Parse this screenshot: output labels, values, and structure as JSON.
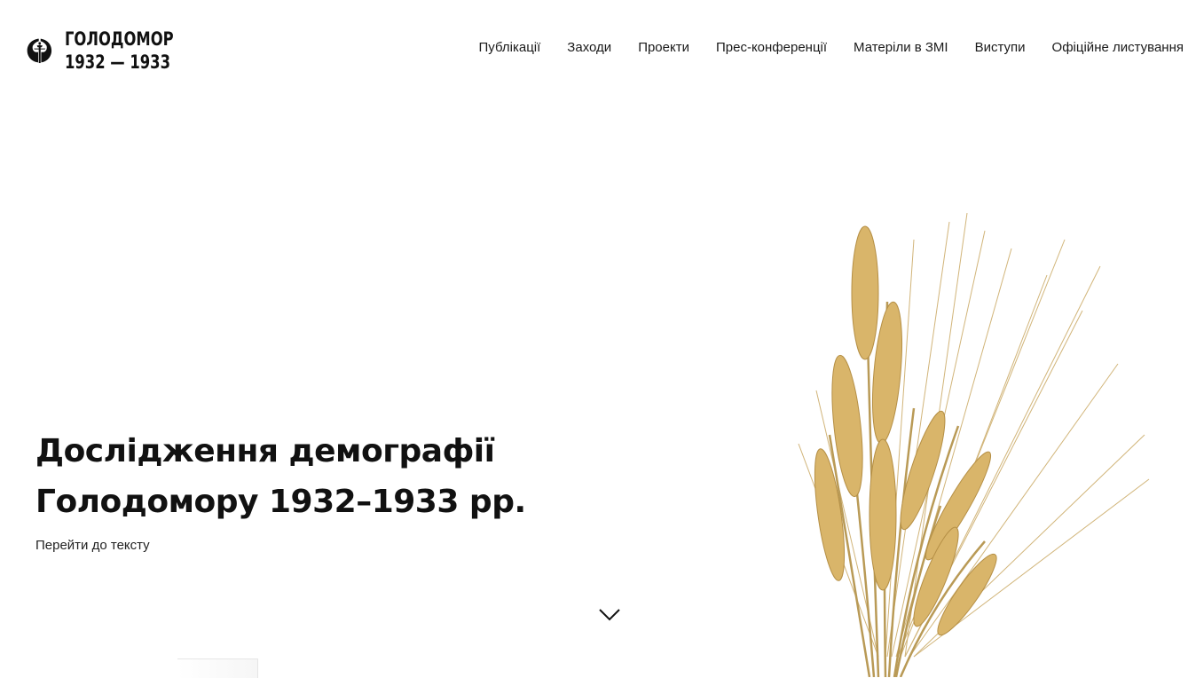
{
  "logo": {
    "line1": "ГОЛОДОМОР",
    "line2": "1932 — 1933",
    "icon": "holodomor-memorial-icon"
  },
  "nav": {
    "items": [
      {
        "label": "Публікації"
      },
      {
        "label": "Заходи"
      },
      {
        "label": "Проекти"
      },
      {
        "label": "Прес-конференції"
      },
      {
        "label": "Матеріли в ЗМІ"
      },
      {
        "label": "Виступи"
      },
      {
        "label": "Офіційне листування"
      }
    ]
  },
  "hero": {
    "title_line1": "Дослідження демографії",
    "title_line2": "Голодомору 1932–1933 рр.",
    "link": "Перейти до тексту",
    "scroll_icon": "chevron-down-icon",
    "image_icon": "wheat-ears-image"
  },
  "colors": {
    "text": "#111111",
    "background": "#ffffff",
    "wheat": "#d9b56a"
  }
}
